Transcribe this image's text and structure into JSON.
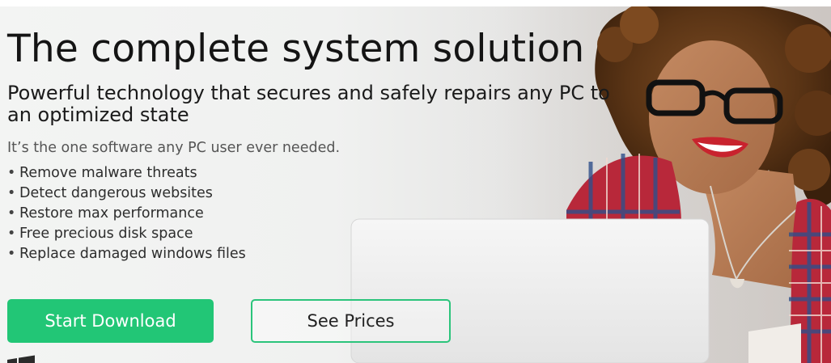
{
  "hero": {
    "headline": "The complete system solution",
    "subheadline": "Powerful technology that secures and safely repairs any PC to an optimized state",
    "intro": "It’s the one software any PC user ever needed.",
    "features": [
      "Remove malware threats",
      "Detect dangerous websites",
      "Restore max performance",
      "Free precious disk space",
      "Replace damaged windows files"
    ],
    "bullet_glyph": "•"
  },
  "buttons": {
    "download_label": "Start Download",
    "prices_label": "See Prices"
  },
  "colors": {
    "accent_green": "#22c676",
    "outline_green": "#2bc47b",
    "headline_text": "#141414"
  },
  "icons": {
    "bottom_left": "windows-logo-icon"
  }
}
